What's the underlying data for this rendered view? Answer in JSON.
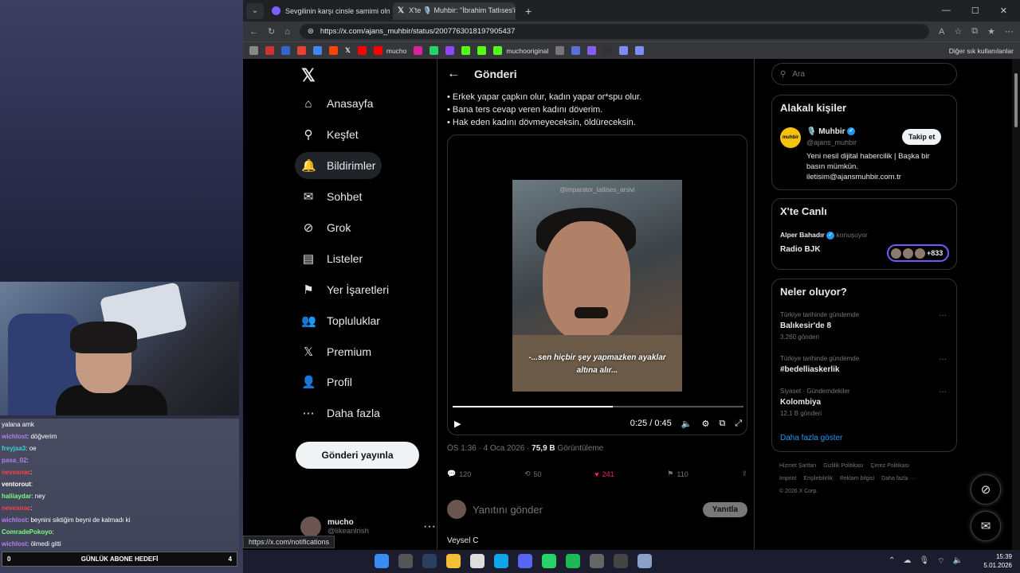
{
  "browser": {
    "tabs": [
      {
        "title": "Sevgilinin karşı cinsle samimi olma"
      },
      {
        "title": "X'te 🎙️ Muhbir: \"İbrahim Tatlıses'i"
      }
    ],
    "url": "https://x.com/ajans_muhbir/status/2007763018197905437",
    "bookmarks": [
      "mucho",
      "muchooriginal"
    ],
    "bookmarks_right": "Diğer sık kullanılanlar",
    "status_url": "https://x.com/notifications"
  },
  "nav": {
    "items": [
      {
        "label": "Anasayfa",
        "icon": "home-icon",
        "glyph": "⌂"
      },
      {
        "label": "Keşfet",
        "icon": "search-icon",
        "glyph": "⚲"
      },
      {
        "label": "Bildirimler",
        "icon": "bell-icon",
        "glyph": "🔔"
      },
      {
        "label": "Sohbet",
        "icon": "mail-icon",
        "glyph": "✉"
      },
      {
        "label": "Grok",
        "icon": "grok-icon",
        "glyph": "⊘"
      },
      {
        "label": "Listeler",
        "icon": "list-icon",
        "glyph": "▤"
      },
      {
        "label": "Yer İşaretleri",
        "icon": "bookmark-icon",
        "glyph": "⚑"
      },
      {
        "label": "Topluluklar",
        "icon": "community-icon",
        "glyph": "👥"
      },
      {
        "label": "Premium",
        "icon": "x-icon",
        "glyph": "𝕏"
      },
      {
        "label": "Profil",
        "icon": "profile-icon",
        "glyph": "👤"
      },
      {
        "label": "Daha fazla",
        "icon": "more-icon",
        "glyph": "⋯"
      }
    ],
    "post_button": "Gönderi yayınla",
    "account": {
      "name": "mucho",
      "handle": "@likeanlrish"
    }
  },
  "main": {
    "title": "Gönderi",
    "lines": [
      "• Erkek yapar çapkın olur, kadın yapar or*spu olur.",
      "• Bana ters cevap veren kadını döverim.",
      "• Hak eden kadını dövmeyeceksin, öldüreceksin."
    ],
    "video": {
      "watermark": "@imparator_tatlises_arsivi",
      "subtitle1": "-...sen hiçbir şey yapmazken ayaklar",
      "subtitle2": "altına alır...",
      "time": "0:25 / 0:45",
      "progress": 0.55
    },
    "meta": {
      "time": "ÖS 1:36 · 4 Oca 2026 · ",
      "views": "75,9 B",
      "views_label": " Görüntüleme"
    },
    "actions": {
      "replies": "120",
      "reposts": "50",
      "likes": "241",
      "bookmarks": "110"
    },
    "reply_placeholder": "Yanıtını gönder",
    "reply_button": "Yanıtla",
    "next_author": "Veysel C"
  },
  "side": {
    "search_placeholder": "Ara",
    "related": {
      "title": "Alakalı kişiler",
      "name": "🎙️ Muhbir",
      "handle": "@ajans_muhbir",
      "bio": "Yeni nesil dijital habercilik | Başka bir basın mümkün. iletisim@ajansmuhbir.com.tr",
      "follow": "Takip et",
      "logo": "muhbir"
    },
    "live": {
      "title": "X'te Canlı",
      "host": "Alper Bahadır",
      "status": "konuşuyor",
      "room": "Radio BJK",
      "count": "+833"
    },
    "trends": {
      "title": "Neler oluyor?",
      "items": [
        {
          "context": "Türkiye tarihinde gündemde",
          "name": "Balıkesir'de 8",
          "count": "3.260 gönderi"
        },
        {
          "context": "Türkiye tarihinde gündemde",
          "name": "#bedelliaskerlik",
          "count": ""
        },
        {
          "context": "Siyaset · Gündemdekiler",
          "name": "Kolombiya",
          "count": "12,1 B gönderi"
        }
      ],
      "more": "Daha fazla göster"
    },
    "footer": [
      "Hizmet Şartları",
      "Gizlilik Politikası",
      "Çerez Politikası",
      "Imprint",
      "Erişilebilirlik",
      "Reklam bilgisi",
      "Daha fazla ···",
      "© 2026 X Corp."
    ]
  },
  "chat": {
    "lines": [
      {
        "user": "",
        "text": "yalana amk",
        "color": "#ffffff"
      },
      {
        "user": "wichlost",
        "text": ": döğverim",
        "color": "#b77cf0"
      },
      {
        "user": "freyjaa3",
        "text": ": oe",
        "color": "#3fd0d0"
      },
      {
        "user": "pasa_02",
        "text": ":",
        "color": "#b77cf0"
      },
      {
        "user": "nevexnac",
        "text": ":",
        "color": "#ff4040"
      },
      {
        "user": "ventorout",
        "text": ":",
        "color": "#ffffff"
      },
      {
        "user": "haliiaydar",
        "text": ": ney",
        "color": "#7cfc7c"
      },
      {
        "user": "nevexnac",
        "text": ":",
        "color": "#ff4040"
      },
      {
        "user": "wichlost",
        "text": ": beynini siktiğim beyni de kalmadı ki",
        "color": "#b77cf0"
      },
      {
        "user": "ComradePokoyo",
        "text": ":",
        "color": "#7cfc7c"
      },
      {
        "user": "wichlost",
        "text": ": ölmedi gitti",
        "color": "#b77cf0"
      }
    ]
  },
  "goal": {
    "left": "0",
    "label": "GÜNLÜK ABONE HEDEFİ",
    "right": "4"
  },
  "taskbar": {
    "time": "15:39",
    "date": "5.01.2026"
  }
}
